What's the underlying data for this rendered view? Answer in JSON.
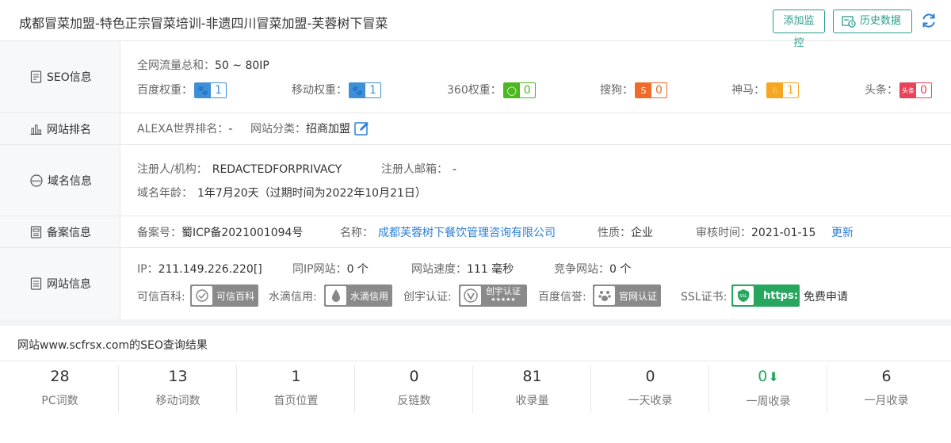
{
  "header": {
    "title": "成都冒菜加盟-特色正宗冒菜培训-非遗四川冒菜加盟-芙蓉树下冒菜",
    "add_monitor": "添加监控",
    "history": "历史数据"
  },
  "seo": {
    "label": "SEO信息",
    "traffic_label": "全网流量总和：",
    "traffic_value": "50 ~ 80IP",
    "weights": [
      {
        "label": "百度权重：",
        "value": "1",
        "icon": "paw-icon",
        "color": "#3f8fd6"
      },
      {
        "label": "移动权重：",
        "value": "1",
        "icon": "paw-icon",
        "color": "#3f8fd6"
      },
      {
        "label": "360权重：",
        "value": "0",
        "icon": "360-icon",
        "color": "#4cb820"
      },
      {
        "label": "搜狗：",
        "value": "0",
        "icon": "sogou-icon",
        "color": "#f06a2a"
      },
      {
        "label": "神马：",
        "value": "1",
        "icon": "shenma-icon",
        "color": "#f5a623"
      },
      {
        "label": "头条：",
        "value": "0",
        "icon": "toutiao-icon",
        "color": "#e8435a",
        "icon_text": "头条"
      }
    ]
  },
  "rank": {
    "label": "网站排名",
    "alexa_label": "ALEXA世界排名：",
    "alexa_value": "-",
    "category_label": "网站分类：",
    "category_value": "招商加盟"
  },
  "domain": {
    "label": "域名信息",
    "registrant_label": "注册人/机构：",
    "registrant_value": "REDACTEDFORPRIVACY",
    "email_label": "注册人邮箱：",
    "email_value": "-",
    "age_label": "域名年龄：",
    "age_value": "1年7月20天（过期时间为2022年10月21日）"
  },
  "icp": {
    "label": "备案信息",
    "number_label": "备案号：",
    "number_value": "蜀ICP备2021001094号",
    "name_label": "名称：",
    "name_value": "成都芙蓉树下餐饮管理咨询有限公司",
    "nature_label": "性质：",
    "nature_value": "企业",
    "audit_label": "审核时间：",
    "audit_value": "2021-01-15",
    "update": "更新"
  },
  "site": {
    "label": "网站信息",
    "ip_label": "IP：",
    "ip_value": "211.149.226.220[]",
    "sameip_label": "同IP网站：",
    "sameip_value": "0 个",
    "speed_label": "网站速度：",
    "speed_value": "111 毫秒",
    "compete_label": "竞争网站：",
    "compete_value": "0 个",
    "certs": [
      {
        "label": "可信百科:",
        "badge": "可信百科",
        "color": "#8a8a8a"
      },
      {
        "label": "水滴信用:",
        "badge": "水滴信用",
        "color": "#8a8a8a"
      },
      {
        "label": "创宇认证:",
        "badge": "创宇认证",
        "color": "#8a8a8a",
        "sub": "★★★★★"
      },
      {
        "label": "百度信誉:",
        "badge": "官网认证",
        "color": "#8a8a8a"
      },
      {
        "label": "SSL证书:",
        "badge": "https:",
        "color": "#27a660"
      }
    ],
    "free_apply": "免费申请"
  },
  "results": {
    "title": "网站www.scfrsx.com的SEO查询结果",
    "stats": [
      {
        "value": "28",
        "label": "PC词数"
      },
      {
        "value": "13",
        "label": "移动词数"
      },
      {
        "value": "1",
        "label": "首页位置"
      },
      {
        "value": "0",
        "label": "反链数"
      },
      {
        "value": "81",
        "label": "收录量"
      },
      {
        "value": "0",
        "label": "一天收录"
      },
      {
        "value": "0",
        "label": "一周收录",
        "trend": "down",
        "color": "#27a660"
      },
      {
        "value": "6",
        "label": "一月收录"
      }
    ]
  }
}
